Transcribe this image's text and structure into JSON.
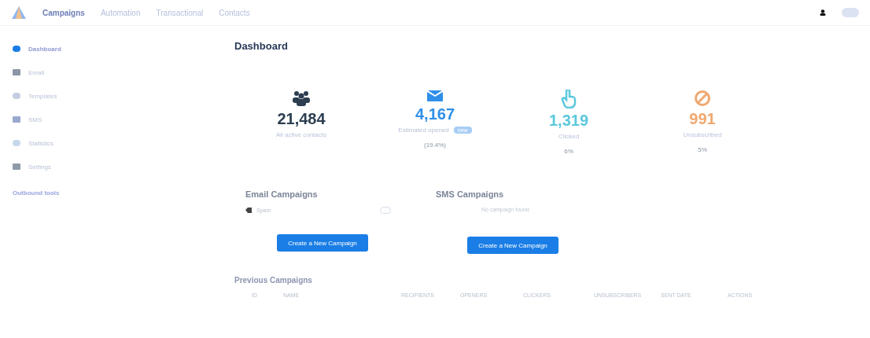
{
  "nav": {
    "toggle": {
      "on": false
    },
    "items": [
      {
        "label": "Campaigns",
        "selected": true
      },
      {
        "label": "Automation",
        "selected": false
      },
      {
        "label": "Transactional",
        "selected": false
      },
      {
        "label": "Contacts",
        "selected": false
      }
    ]
  },
  "sidebar": {
    "items": [
      {
        "label": "Dashboard",
        "selected": true
      },
      {
        "label": "Email",
        "selected": false
      },
      {
        "label": "Templates",
        "selected": false
      },
      {
        "label": "SMS",
        "selected": false
      },
      {
        "label": "Statistics",
        "selected": false
      },
      {
        "label": "Settings",
        "selected": false
      }
    ],
    "link": "Outbound tools"
  },
  "page_title": "Dashboard",
  "stats": [
    {
      "kind": "contacts",
      "value": "21,484",
      "label": "All active contacts",
      "color": "#2c3e50"
    },
    {
      "kind": "opened",
      "value": "4,167",
      "label": "Estimated opened",
      "badge": "new",
      "note": "(19.4%)",
      "color": "#2f8fe8"
    },
    {
      "kind": "clicked",
      "value": "1,319",
      "label": "Clicked",
      "note": "6%",
      "color": "#5bc8dc"
    },
    {
      "kind": "unsubscribed",
      "value": "991",
      "label": "Unsubscribed",
      "note": "5%",
      "color": "#f0a870"
    }
  ],
  "email_campaigns": {
    "title": "Email Campaigns",
    "items": [
      {
        "name": "Spam"
      }
    ],
    "button": "Create a New Campaign"
  },
  "sms_campaigns": {
    "title": "SMS Campaigns",
    "empty": "No campaign found",
    "button": "Create a New Campaign"
  },
  "previous": {
    "title": "Previous Campaigns",
    "columns": [
      "ID",
      "NAME",
      "RECIPIENTS",
      "OPENERS",
      "CLICKERS",
      "UNSUBSCRIBERS",
      "SENT DATE",
      "ACTIONS"
    ]
  }
}
